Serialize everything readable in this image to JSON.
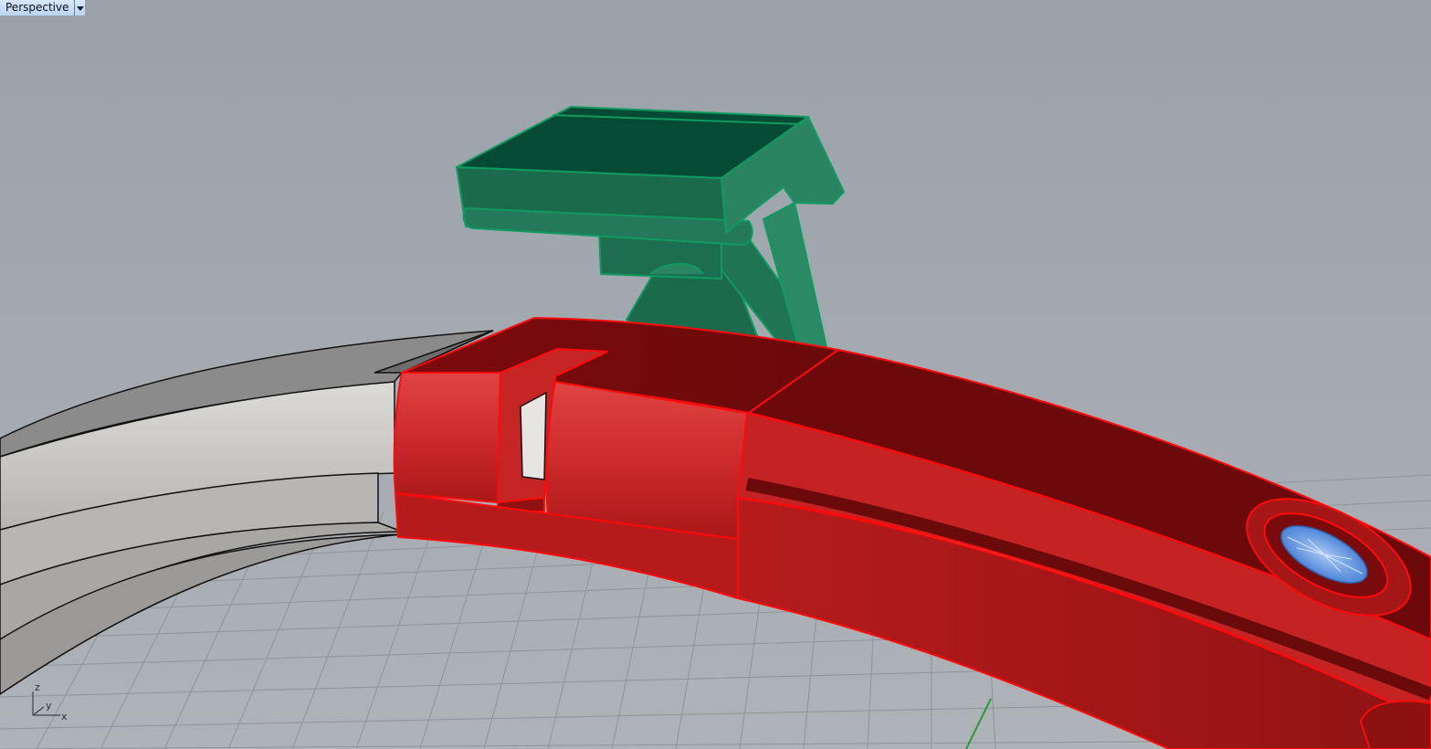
{
  "viewport": {
    "title": "Perspective",
    "menu_icon": "chevron-down-icon",
    "background_color": "#9ea4ab"
  },
  "axes": {
    "z_label": "z",
    "y_label": "y",
    "x_label": "x"
  },
  "colors": {
    "selected_part": "#d8262b",
    "selected_edge": "#ff0a0a",
    "clip_part": "#1c6b4e",
    "clip_edge": "#0b9c5e",
    "base_ring": "#c9c7c4",
    "gem": "#7aa9ea",
    "grid_line": "#8b9096"
  }
}
